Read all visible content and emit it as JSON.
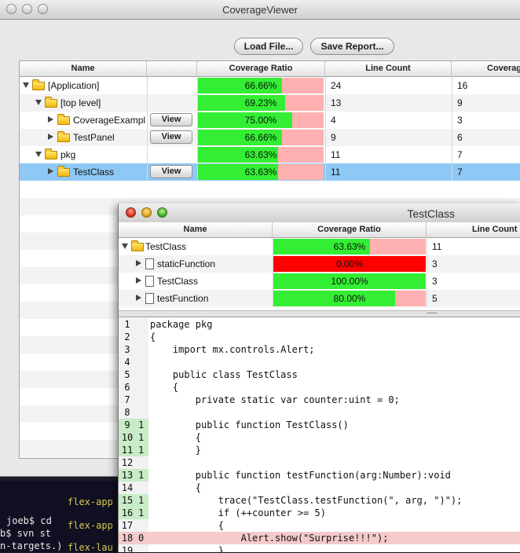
{
  "main_window": {
    "title": "CoverageViewer",
    "toolbar": {
      "load_label": "Load File...",
      "save_label": "Save Report..."
    },
    "columns": [
      "Name",
      "Coverage Ratio",
      "Line Count",
      "Coverag"
    ],
    "rows": [
      {
        "name": "[Application]",
        "level": 0,
        "expanded": true,
        "view": false,
        "ratio": "66.66%",
        "ratio_value": 0.6666,
        "lines": "24",
        "covered": "16",
        "selected": false
      },
      {
        "name": "[top level]",
        "level": 1,
        "expanded": true,
        "view": false,
        "ratio": "69.23%",
        "ratio_value": 0.6923,
        "lines": "13",
        "covered": "9",
        "selected": false
      },
      {
        "name": "CoverageExampl",
        "level": 2,
        "expanded": false,
        "view": true,
        "ratio": "75.00%",
        "ratio_value": 0.75,
        "lines": "4",
        "covered": "3",
        "selected": false
      },
      {
        "name": "TestPanel",
        "level": 2,
        "expanded": false,
        "view": true,
        "ratio": "66.66%",
        "ratio_value": 0.6666,
        "lines": "9",
        "covered": "6",
        "selected": false
      },
      {
        "name": "pkg",
        "level": 1,
        "expanded": true,
        "view": false,
        "ratio": "63.63%",
        "ratio_value": 0.6363,
        "lines": "11",
        "covered": "7",
        "selected": false
      },
      {
        "name": "TestClass",
        "level": 2,
        "expanded": false,
        "view": true,
        "ratio": "63.63%",
        "ratio_value": 0.6363,
        "lines": "11",
        "covered": "7",
        "selected": true
      }
    ],
    "view_label": "View"
  },
  "detail_window": {
    "title": "TestClass",
    "columns": [
      "Name",
      "Coverage Ratio",
      "Line Count"
    ],
    "rows": [
      {
        "name": "TestClass",
        "kind": "folder",
        "expanded": true,
        "ratio": "63.63%",
        "ratio_value": 0.6363,
        "lines": "11"
      },
      {
        "name": "staticFunction",
        "kind": "doc",
        "expanded": false,
        "ratio": "0.00%",
        "ratio_value": 0,
        "lines": "3"
      },
      {
        "name": "TestClass",
        "kind": "doc",
        "expanded": false,
        "ratio": "100.00%",
        "ratio_value": 1,
        "lines": "3"
      },
      {
        "name": "testFunction",
        "kind": "doc",
        "expanded": false,
        "ratio": "80.00%",
        "ratio_value": 0.8,
        "lines": "5"
      }
    ],
    "code": [
      {
        "n": "1",
        "hits": "",
        "text": "package pkg"
      },
      {
        "n": "2",
        "hits": "",
        "text": "{"
      },
      {
        "n": "3",
        "hits": "",
        "text": "    import mx.controls.Alert;"
      },
      {
        "n": "4",
        "hits": "",
        "text": ""
      },
      {
        "n": "5",
        "hits": "",
        "text": "    public class TestClass"
      },
      {
        "n": "6",
        "hits": "",
        "text": "    {"
      },
      {
        "n": "7",
        "hits": "",
        "text": "        private static var counter:uint = 0;"
      },
      {
        "n": "8",
        "hits": "",
        "text": ""
      },
      {
        "n": "9",
        "hits": "1",
        "text": "        public function TestClass()"
      },
      {
        "n": "10",
        "hits": "1",
        "text": "        {"
      },
      {
        "n": "11",
        "hits": "1",
        "text": "        }"
      },
      {
        "n": "12",
        "hits": "",
        "text": ""
      },
      {
        "n": "13",
        "hits": "1",
        "text": "        public function testFunction(arg:Number):void"
      },
      {
        "n": "14",
        "hits": "",
        "text": "        {"
      },
      {
        "n": "15",
        "hits": "1",
        "text": "            trace(\"TestClass.testFunction(\", arg, \")\");"
      },
      {
        "n": "16",
        "hits": "1",
        "text": "            if (++counter >= 5)"
      },
      {
        "n": "17",
        "hits": "",
        "text": "            {"
      },
      {
        "n": "18",
        "hits": "0",
        "text": "                Alert.show(\"Surprise!!!\");"
      },
      {
        "n": "19",
        "hits": "",
        "text": "            }"
      }
    ]
  },
  "terminal": {
    "lines": [
      "joeb$ cd",
      "b$ svn st",
      "n-targets.)"
    ],
    "right_lines": [
      "flex-app",
      "flex-app",
      "flex-lau"
    ]
  },
  "colors": {
    "covered": "#33ee33",
    "uncovered": "#ffb0b0",
    "zero": "#ff0000",
    "selection": "#8ec8f4"
  }
}
